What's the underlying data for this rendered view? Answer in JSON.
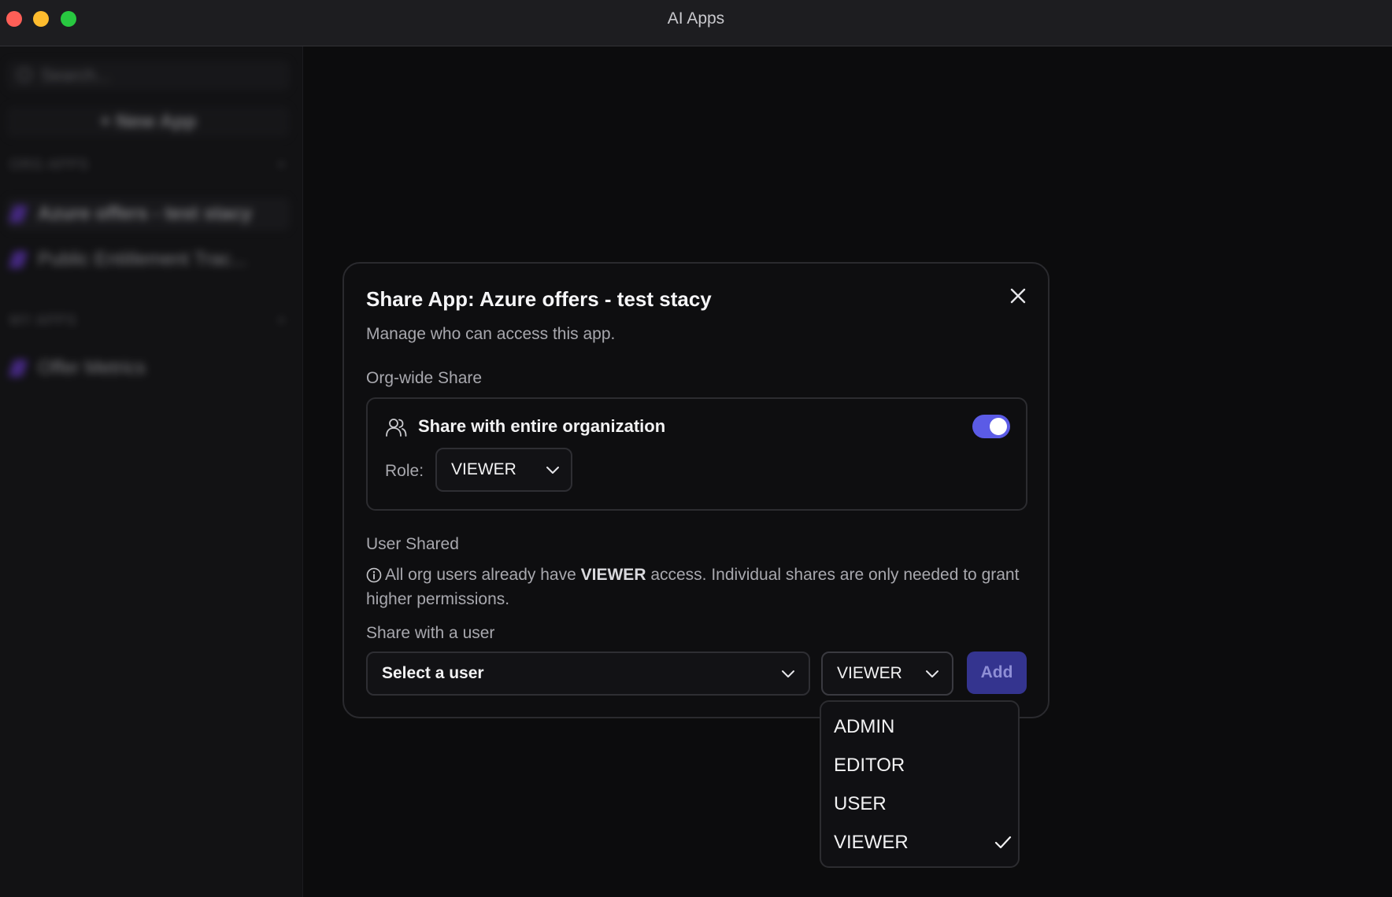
{
  "window": {
    "title": "AI Apps"
  },
  "sidebar": {
    "search_placeholder": "Search...",
    "new_app_label": "+ New App",
    "sections": [
      {
        "title": "ORG APPS",
        "items": [
          {
            "label": "Azure offers - test stacy",
            "active": true
          },
          {
            "label": "Public Entitlement Trac..."
          }
        ]
      },
      {
        "title": "MY APPS",
        "items": [
          {
            "label": "Offer Metrics"
          }
        ]
      }
    ]
  },
  "dialog": {
    "title": "Share App: Azure offers - test stacy",
    "description": "Manage who can access this app.",
    "org_section_label": "Org-wide Share",
    "org_share_label": "Share with entire organization",
    "org_share_enabled": true,
    "role_label": "Role:",
    "org_role_value": "VIEWER",
    "user_section_label": "User Shared",
    "info_prefix": "All org users already have ",
    "info_role": "VIEWER",
    "info_suffix": " access. Individual shares are only needed to grant higher permissions.",
    "share_with_user_label": "Share with a user",
    "user_select_placeholder": "Select a user",
    "user_role_value": "VIEWER",
    "add_button_label": "Add"
  },
  "role_dropdown": {
    "options": [
      "ADMIN",
      "EDITOR",
      "USER",
      "VIEWER"
    ],
    "selected": "VIEWER"
  },
  "colors": {
    "accent": "#5b5be6",
    "add_button_bg": "#34348f",
    "background": "#0c0c0d"
  }
}
